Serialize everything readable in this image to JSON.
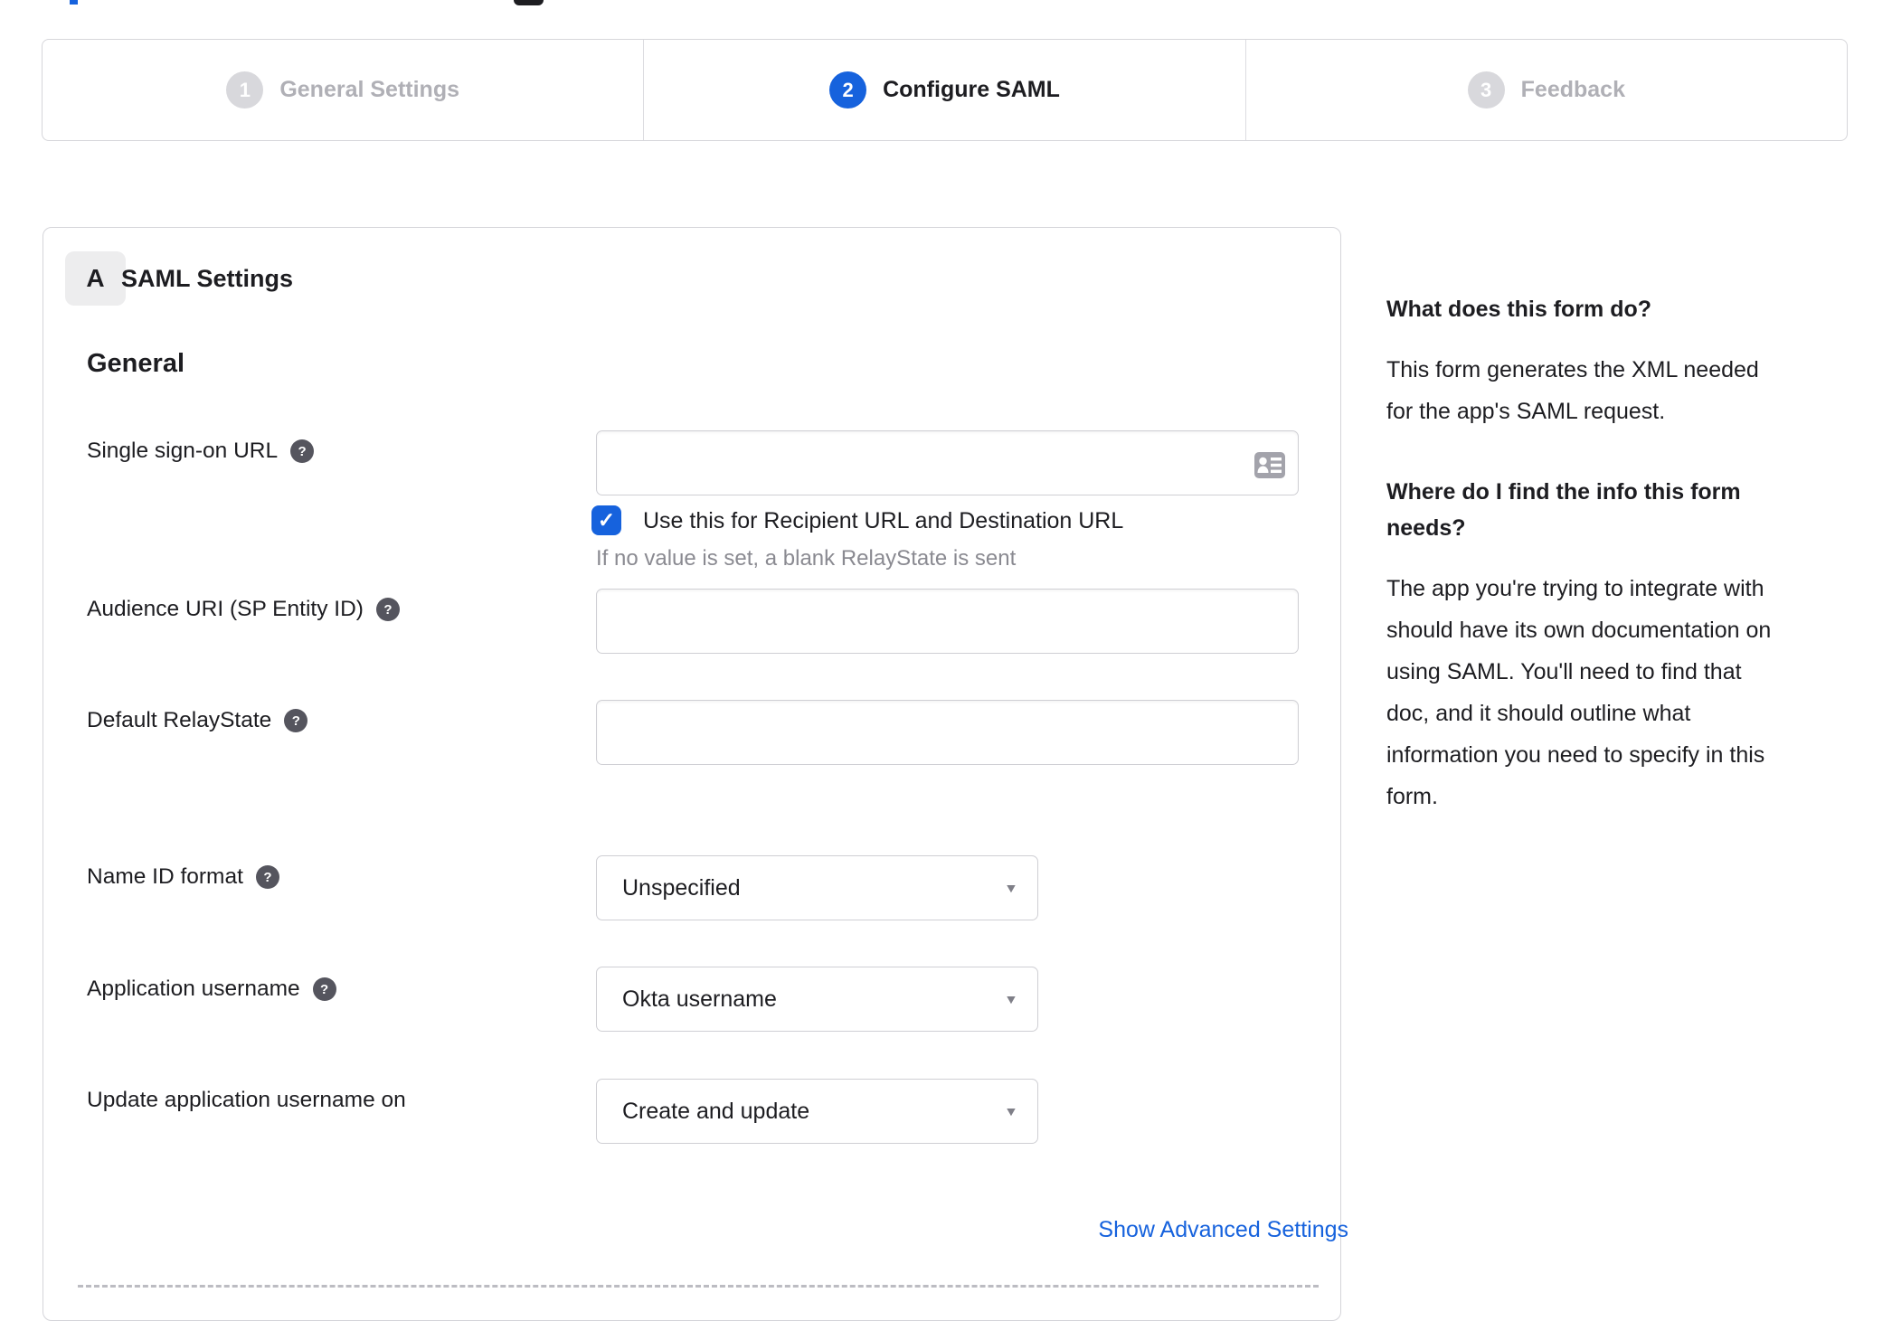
{
  "stepper": {
    "steps": [
      {
        "number": "1",
        "label": "General Settings"
      },
      {
        "number": "2",
        "label": "Configure SAML"
      },
      {
        "number": "3",
        "label": "Feedback"
      }
    ],
    "active_step": "Configure SAML"
  },
  "panel": {
    "badge": "A",
    "title": "SAML Settings",
    "section": "General",
    "fields": {
      "sso_url": {
        "label": "Single sign-on URL",
        "value": "",
        "checkbox_label": "Use this for Recipient URL and Destination URL",
        "checkbox_checked": true
      },
      "audience_uri": {
        "label": "Audience URI (SP Entity ID)",
        "value": ""
      },
      "relay_state": {
        "label": "Default RelayState",
        "value": "",
        "helper": "If no value is set, a blank RelayState is sent"
      },
      "name_id_format": {
        "label": "Name ID format",
        "value": "Unspecified"
      },
      "app_username": {
        "label": "Application username",
        "value": "Okta username"
      },
      "update_username": {
        "label": "Update application username on",
        "value": "Create and update"
      }
    },
    "advanced_link": "Show Advanced Settings"
  },
  "sidebar": {
    "sections": [
      {
        "heading": [
          "What does this form do?"
        ],
        "body": [
          "This form generates the XML needed",
          "for the app's SAML request."
        ]
      },
      {
        "heading": [
          "Where do I find the info this form",
          "needs?"
        ],
        "body": [
          "The app you're trying to integrate with",
          "should have its own documentation on",
          "using SAML. You'll need to find that",
          "doc, and it should outline what",
          "information you need to specify in this",
          "form."
        ]
      }
    ]
  },
  "icons": {
    "help_glyph": "?",
    "check_glyph": "✓",
    "caret_glyph": "▼"
  },
  "colors": {
    "accent_blue": "#1662dd",
    "inactive_circle_gray": "#d8d8dc",
    "inactive_label_gray": "#b0b0b6",
    "text_dark": "#1d1d21",
    "muted_text": "#8a8a91",
    "panel_border": "#d4d4d9",
    "link_blue": "#1662dd"
  }
}
